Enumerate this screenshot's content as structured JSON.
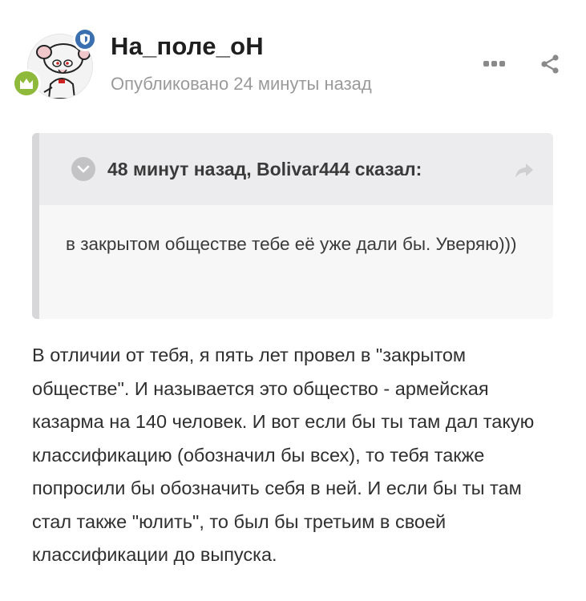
{
  "author": {
    "username": "На_поле_оН",
    "avatar_icon": "brain-cartoon-avatar",
    "role_badge_icon": "shield-icon",
    "rank_badge_icon": "crown-icon"
  },
  "post": {
    "meta": "Опубликовано 24 минуты назад",
    "body": "В отличии от тебя, я пять лет провел в \"закрытом обществе\". И называется это общество - армейская казарма на 140 человек. И вот если бы ты там дал такую классификацию (обозначил бы всех), то тебя также попросили бы обозначить себя в ней. И если бы ты там стал также \"юлить\", то был бы третьим в своей классификации до выпуска."
  },
  "quote": {
    "citation": "48 минут назад, Bolivar444 сказал:",
    "body": "в закрытом обществе тебе её уже дали бы. Уверяю)))",
    "toggle_icon": "chevron-down-icon",
    "jump_icon": "share-arrow-icon"
  },
  "actions": {
    "more_icon": "more-dots-icon",
    "share_icon": "share-icon"
  },
  "colors": {
    "role_badge": "#3a6fb0",
    "rank_badge": "#8fb93a",
    "quote_background": "#f7f7f8",
    "quote_header": "#ececee",
    "meta_text": "#9a9a9a"
  }
}
